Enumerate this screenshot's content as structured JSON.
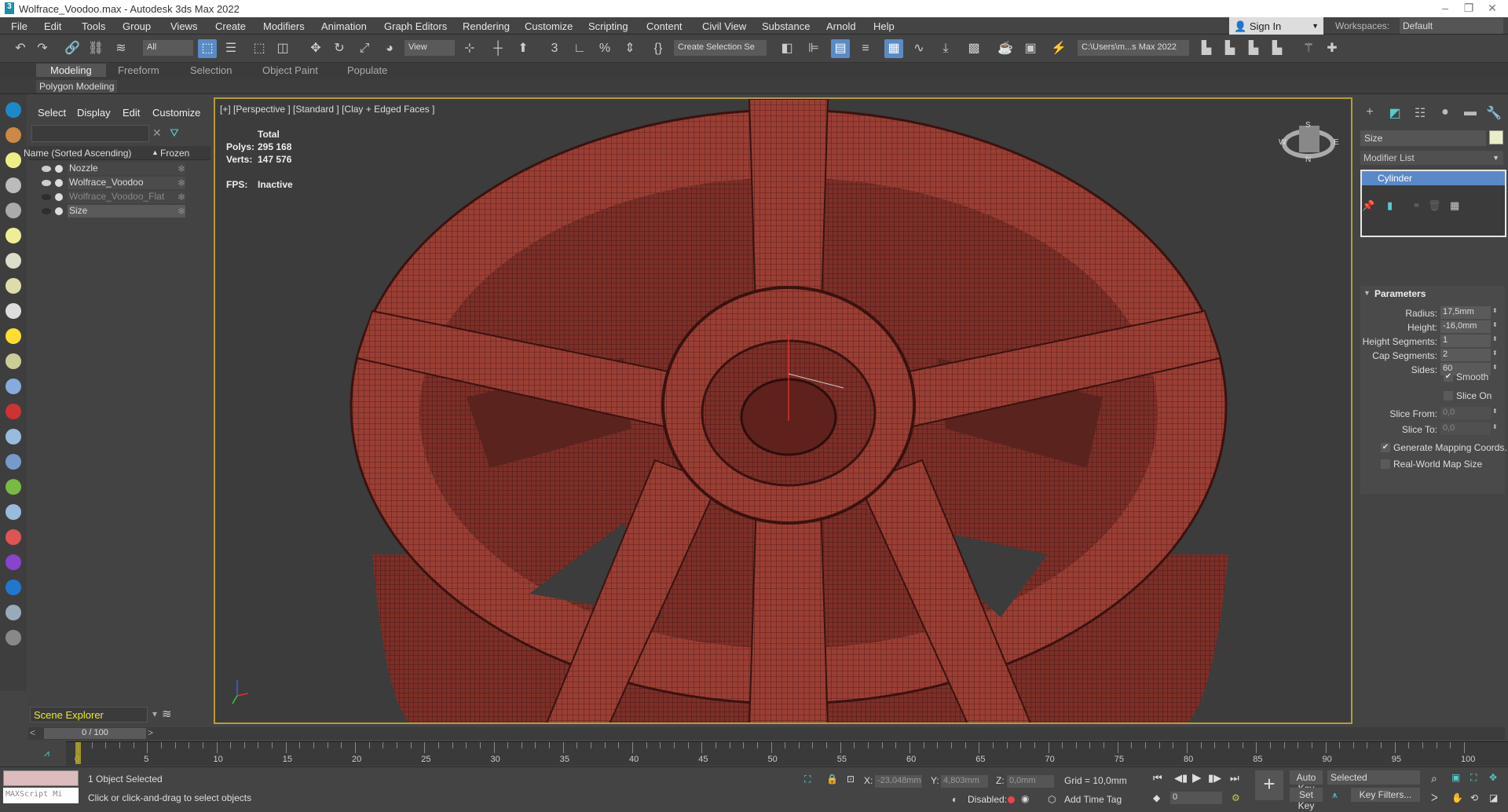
{
  "window": {
    "title": "Wolfrace_Voodoo.max - Autodesk 3ds Max 2022",
    "app_icon": "3",
    "minimize": "–",
    "maximize": "❐",
    "close": "✕"
  },
  "menu": [
    "File",
    "Edit",
    "Tools",
    "Group",
    "Views",
    "Create",
    "Modifiers",
    "Animation",
    "Graph Editors",
    "Rendering",
    "Customize",
    "Scripting",
    "Content",
    "Civil View",
    "Substance",
    "Arnold",
    "Help"
  ],
  "signin": {
    "label": "Sign In"
  },
  "workspaces": {
    "label": "Workspaces:",
    "value": "Default"
  },
  "toolbar": {
    "selection_filter": "All",
    "ref_coord": "View",
    "named_selection": "Create Selection Se",
    "project_path": "C:\\Users\\m...s Max 2022"
  },
  "ribbon": {
    "tabs": [
      "Modeling",
      "Freeform",
      "Selection",
      "Object Paint",
      "Populate"
    ],
    "active": "Modeling",
    "sub": "Polygon Modeling"
  },
  "scene_explorer": {
    "menus": [
      "Select",
      "Display",
      "Edit",
      "Customize"
    ],
    "col_name": "Name (Sorted Ascending)",
    "sort_arrow": "▲",
    "col_frozen": "Frozen",
    "rows": [
      {
        "name": "Nozzle"
      },
      {
        "name": "Wolfrace_Voodoo"
      },
      {
        "name": "Wolfrace_Voodoo_Flat"
      },
      {
        "name": "Size"
      }
    ],
    "footer": "Scene Explorer"
  },
  "viewport": {
    "label": "[+] [Perspective ] [Standard ] [Clay + Edged Faces ]",
    "stats": {
      "total": "Total",
      "polys_label": "Polys:",
      "polys": "295 168",
      "verts_label": "Verts:",
      "verts": "147 576",
      "fps_label": "FPS:",
      "fps": "Inactive"
    },
    "viewcube": {
      "n": "N",
      "s": "S",
      "e": "E",
      "w": "W"
    }
  },
  "command_panel": {
    "object_name": "Size",
    "modifier_list": "Modifier List",
    "stack": [
      "Cylinder"
    ],
    "rollout": "Parameters",
    "params": [
      {
        "label": "Radius:",
        "value": "17,5mm"
      },
      {
        "label": "Height:",
        "value": "-16,0mm"
      },
      {
        "label": "Height Segments:",
        "value": "1"
      },
      {
        "label": "Cap Segments:",
        "value": "2"
      },
      {
        "label": "Sides:",
        "value": "60"
      }
    ],
    "smooth": {
      "label": "Smooth",
      "checked": true
    },
    "slice_on": {
      "label": "Slice On",
      "checked": false
    },
    "slice_from": {
      "label": "Slice From:",
      "value": "0,0"
    },
    "slice_to": {
      "label": "Slice To:",
      "value": "0,0"
    },
    "gen_mapping": {
      "label": "Generate Mapping Coords.",
      "checked": true
    },
    "real_world": {
      "label": "Real-World Map Size",
      "checked": false
    }
  },
  "timeline": {
    "position": "0 / 100",
    "current_frame": 0,
    "labels": [
      "0",
      "5",
      "10",
      "15",
      "20",
      "25",
      "30",
      "35",
      "40",
      "45",
      "50",
      "55",
      "60",
      "65",
      "70",
      "75",
      "80",
      "85",
      "90",
      "95",
      "100"
    ]
  },
  "status": {
    "selected": "1 Object Selected",
    "prompt": "Click or click-and-drag to select objects",
    "maxscript": "MAXScript Mi",
    "x_label": "X:",
    "x": "-23,048mm",
    "y_label": "Y:",
    "y": "4,803mm",
    "z_label": "Z:",
    "z": "0,0mm",
    "grid": "Grid = 10,0mm",
    "disabled": "Disabled:",
    "add_time_tag": "Add Time Tag",
    "auto_key": "Auto Key",
    "set_key": "Set Key",
    "key_mode": "Selected",
    "key_filters": "Key Filters...",
    "frame": "0"
  },
  "colors": {
    "accent": "#5b89c7",
    "viewport_border": "#b89a3a",
    "wheel": "#8e3a32",
    "scene_footer": "#e8e830"
  }
}
